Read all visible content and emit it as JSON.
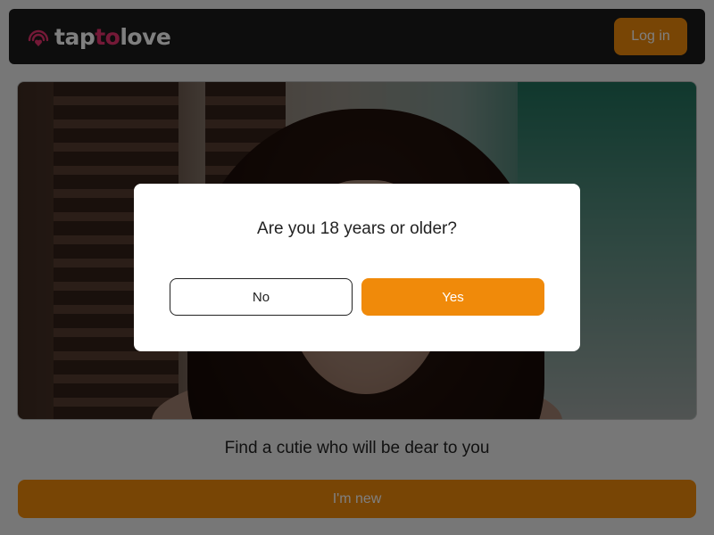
{
  "header": {
    "logo": {
      "part1": "tap",
      "part2": "to",
      "part3": "love",
      "icon": "signal-heart-icon"
    },
    "login_label": "Log in"
  },
  "hero": {
    "image": "woman-portrait-photo"
  },
  "tagline": "Find a cutie who will be dear to you",
  "new_button_label": "I'm new",
  "age_modal": {
    "question": "Are you 18 years or older?",
    "no_label": "No",
    "yes_label": "Yes"
  },
  "colors": {
    "accent": "#f08a0a",
    "brand_pink": "#e8326e",
    "header_bg": "#1a1a1a",
    "page_bg": "#efefef"
  }
}
